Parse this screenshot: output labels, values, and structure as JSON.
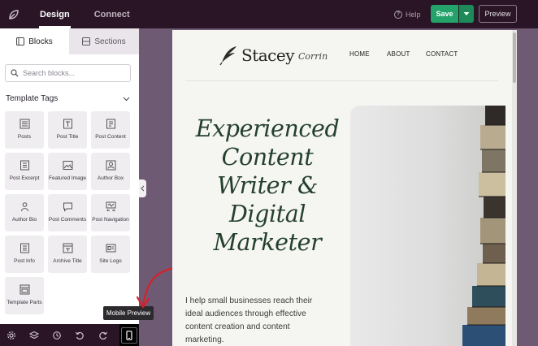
{
  "topbar": {
    "tabs": [
      {
        "label": "Design",
        "active": true
      },
      {
        "label": "Connect",
        "active": false
      }
    ],
    "help_label": "Help",
    "save_label": "Save",
    "preview_label": "Preview"
  },
  "sidebar": {
    "tabs": [
      {
        "label": "Blocks",
        "icon": "blocks-icon",
        "active": true
      },
      {
        "label": "Sections",
        "icon": "sections-icon",
        "active": false
      }
    ],
    "search_placeholder": "Search blocks...",
    "section_title": "Template Tags",
    "blocks": [
      {
        "label": "Posts",
        "icon": "posts-icon"
      },
      {
        "label": "Post Title",
        "icon": "post-title-icon"
      },
      {
        "label": "Post Content",
        "icon": "post-content-icon"
      },
      {
        "label": "Post Excerpt",
        "icon": "post-excerpt-icon"
      },
      {
        "label": "Featured Image",
        "icon": "featured-image-icon"
      },
      {
        "label": "Author Box",
        "icon": "author-box-icon"
      },
      {
        "label": "Author Bio",
        "icon": "author-bio-icon"
      },
      {
        "label": "Post Comments",
        "icon": "post-comments-icon"
      },
      {
        "label": "Post Navigation",
        "icon": "post-navigation-icon"
      },
      {
        "label": "Post Info",
        "icon": "post-info-icon"
      },
      {
        "label": "Archive Title",
        "icon": "archive-title-icon"
      },
      {
        "label": "Site Logo",
        "icon": "site-logo-icon"
      },
      {
        "label": "Template Parts",
        "icon": "template-parts-icon"
      }
    ]
  },
  "bottombar": {
    "tools": [
      "settings-icon",
      "layers-icon",
      "history-icon",
      "undo-icon",
      "redo-icon",
      "mobile-preview-icon"
    ],
    "tooltip": "Mobile Preview"
  },
  "preview": {
    "logo_name": "Stacey",
    "logo_script": "Corrin",
    "nav": [
      "HOME",
      "ABOUT",
      "CONTACT"
    ],
    "hero_title": [
      "Experienced",
      "Content",
      "Writer &",
      "Digital",
      "Marketer"
    ],
    "hero_text": "I help small businesses reach their ideal audiences through effective content creation and content marketing."
  },
  "colors": {
    "topbar_bg": "#2a1527",
    "save_green": "#23a26a",
    "canvas_bg": "#6f5a74",
    "hero_title": "#24402d",
    "annotation_red": "#d4222a"
  }
}
